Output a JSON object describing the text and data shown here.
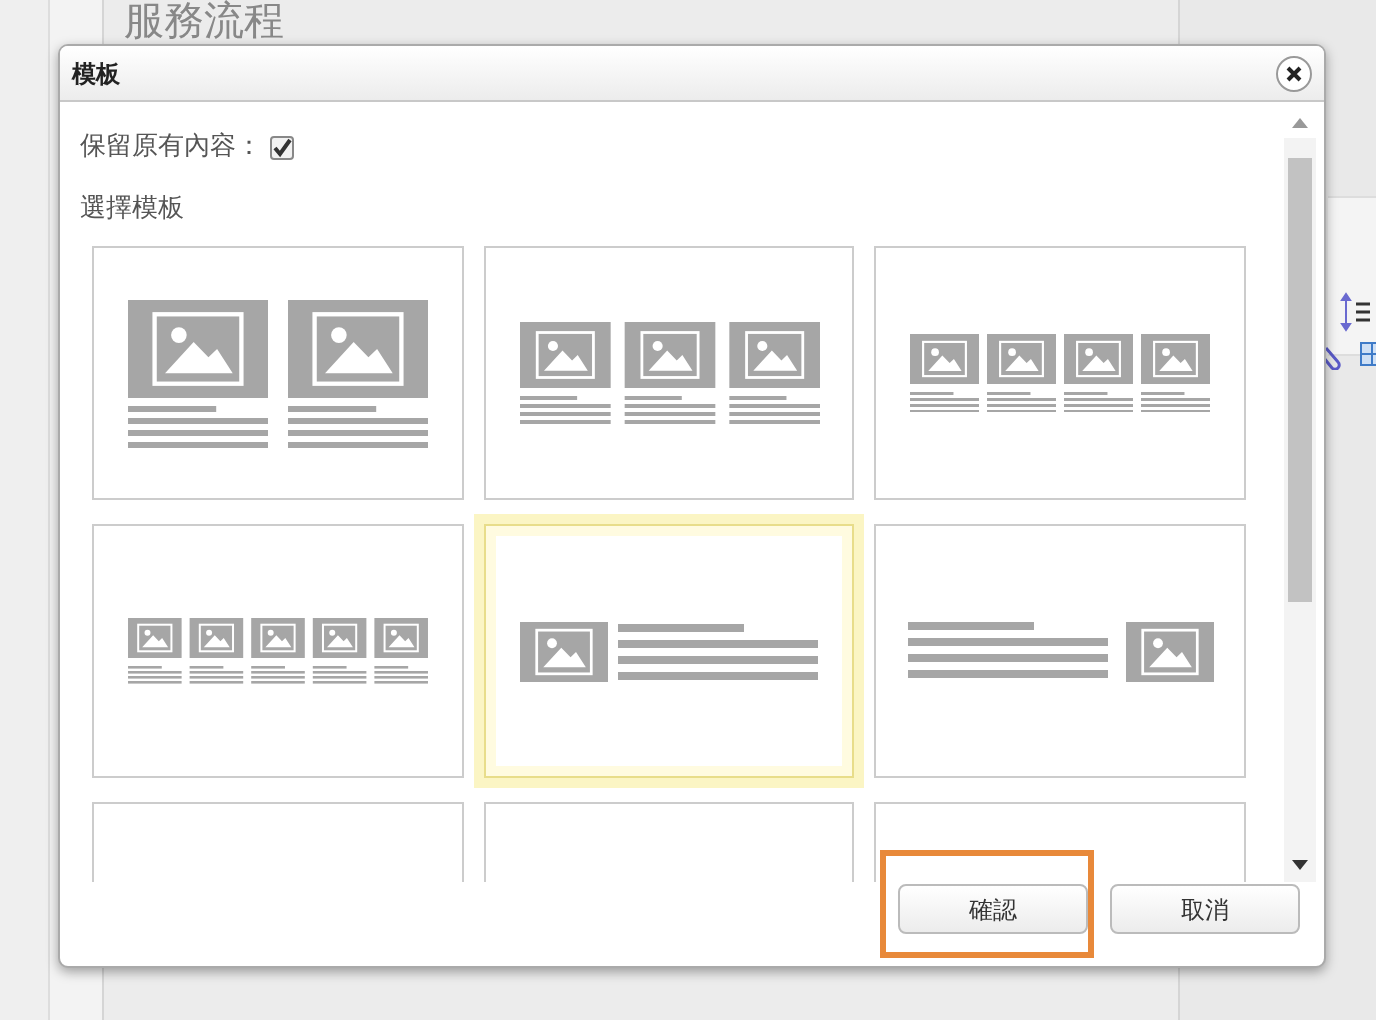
{
  "page": {
    "heading": "服務流程"
  },
  "dialog": {
    "title": "模板",
    "keep_content": {
      "label": "保留原有內容：",
      "checked": true
    },
    "section_label": "選擇模板",
    "templates": [
      {
        "kind": "grid-2",
        "selected": false
      },
      {
        "kind": "grid-3",
        "selected": false
      },
      {
        "kind": "grid-4",
        "selected": false
      },
      {
        "kind": "grid-5",
        "selected": false
      },
      {
        "kind": "image-left",
        "selected": true
      },
      {
        "kind": "image-right",
        "selected": false
      },
      {
        "kind": "blank",
        "selected": false
      },
      {
        "kind": "blank",
        "selected": false
      },
      {
        "kind": "blank",
        "selected": false
      }
    ],
    "buttons": [
      {
        "label": "確認",
        "highlighted": true
      },
      {
        "label": "取消",
        "highlighted": false
      }
    ]
  }
}
